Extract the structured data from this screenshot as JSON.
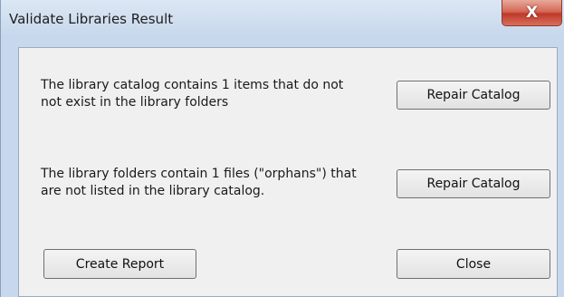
{
  "window": {
    "title": "Validate Libraries Result",
    "close_glyph": "X"
  },
  "sections": [
    {
      "message": "The library catalog  contains 1 items that do not\nnot exist in the library folders",
      "button_label": "Repair Catalog"
    },
    {
      "message": "The library folders contain 1 files  (\"orphans\") that\nare  not listed in the library catalog.",
      "button_label": "Repair Catalog"
    }
  ],
  "footer": {
    "create_report_label": "Create Report",
    "close_label": "Close"
  },
  "colors": {
    "title_bar": "#c7d8ec",
    "client_background": "#f0f0f0",
    "close_button": "#c0392b"
  }
}
